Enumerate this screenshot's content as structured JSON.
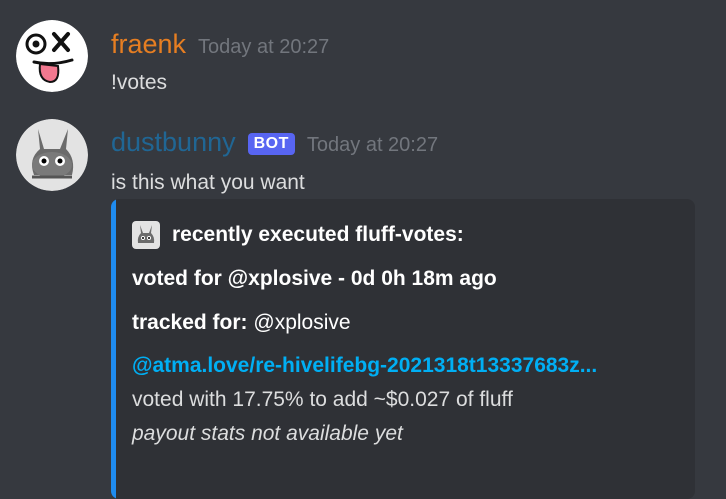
{
  "messages": [
    {
      "username": "fraenk",
      "username_color": "#e67e22",
      "timestamp": "Today at 20:27",
      "text": "!votes"
    },
    {
      "username": "dustbunny",
      "username_color": "#206694",
      "badge": "BOT",
      "timestamp": "Today at 20:27",
      "text": "is this what you want",
      "embed": {
        "author": "recently executed fluff-votes:",
        "voted_for": "voted for @xplosive - 0d 0h 18m ago",
        "tracked_for_label": "tracked for:",
        "tracked_for_user": "@xplosive",
        "link": "@atma.love/re-hivelifebg-2021318t13337683z...",
        "voted_with": "voted with 17.75% to add ~$0.027 of fluff",
        "payout_note": "payout stats not available yet",
        "accent_color": "#1f8cf0"
      }
    }
  ]
}
